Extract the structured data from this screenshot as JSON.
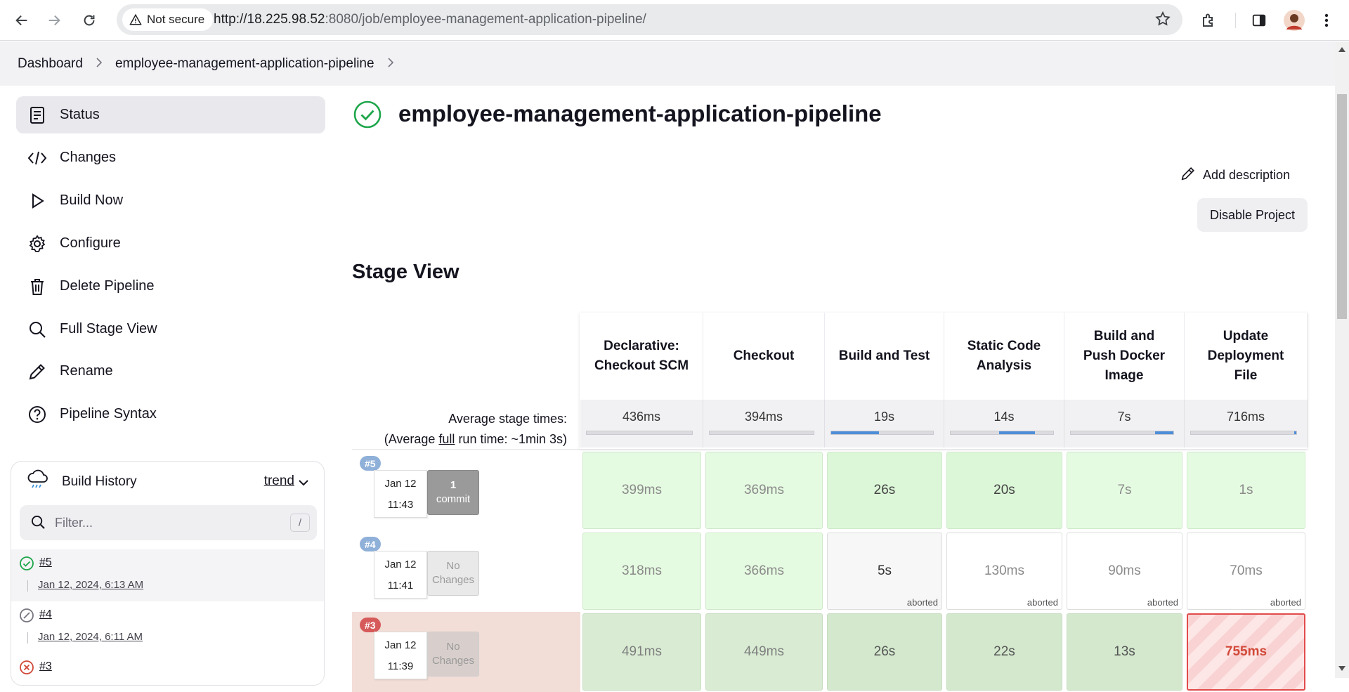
{
  "browser": {
    "security_label": "Not secure",
    "url_host": "http://18.225.98.52",
    "url_path": ":8080/job/employee-management-application-pipeline/"
  },
  "breadcrumb": {
    "items": [
      "Dashboard",
      "employee-management-application-pipeline"
    ]
  },
  "sidebar": {
    "items": [
      {
        "label": "Status",
        "icon": "status-icon"
      },
      {
        "label": "Changes",
        "icon": "code-icon"
      },
      {
        "label": "Build Now",
        "icon": "play-icon"
      },
      {
        "label": "Configure",
        "icon": "gear-icon"
      },
      {
        "label": "Delete Pipeline",
        "icon": "trash-icon"
      },
      {
        "label": "Full Stage View",
        "icon": "search-icon"
      },
      {
        "label": "Rename",
        "icon": "pencil-icon"
      },
      {
        "label": "Pipeline Syntax",
        "icon": "help-icon"
      }
    ]
  },
  "build_history": {
    "title": "Build History",
    "trend_label": "trend",
    "filter_placeholder": "Filter...",
    "filter_shortcut": "/",
    "builds": [
      {
        "number": "#5",
        "date": "Jan 12, 2024, 6:13 AM",
        "status": "success"
      },
      {
        "number": "#4",
        "date": "Jan 12, 2024, 6:11 AM",
        "status": "aborted"
      },
      {
        "number": "#3",
        "date": "",
        "status": "failed"
      }
    ]
  },
  "main": {
    "title": "employee-management-application-pipeline",
    "add_description": "Add description",
    "disable_project": "Disable Project",
    "stage_view_title": "Stage View"
  },
  "stage_view": {
    "avg_label_1": "Average stage times:",
    "avg_label_2_prefix": "(Average ",
    "avg_label_2_link": "full",
    "avg_label_2_suffix": " run time: ~1min 3s)",
    "stages": [
      {
        "name": "Declarative: Checkout SCM",
        "avg": "436ms",
        "bar_start": 0,
        "bar_fill": 0
      },
      {
        "name": "Checkout",
        "avg": "394ms",
        "bar_start": 0,
        "bar_fill": 0
      },
      {
        "name": "Build and Test",
        "avg": "19s",
        "bar_start": 0,
        "bar_fill": 0.47
      },
      {
        "name": "Static Code Analysis",
        "avg": "14s",
        "bar_start": 0.47,
        "bar_fill": 0.35
      },
      {
        "name": "Build and Push Docker Image",
        "avg": "7s",
        "bar_start": 0.82,
        "bar_fill": 0.18
      },
      {
        "name": "Update Deployment File",
        "avg": "716ms",
        "bar_start": 0.98,
        "bar_fill": 0.02
      }
    ],
    "runs": [
      {
        "badge": "#5",
        "badge_color": "#8fb0d8",
        "date": "Jan 12",
        "time": "11:43",
        "commit_line1": "1",
        "commit_line2": "commit",
        "cells": [
          {
            "value": "399ms",
            "state": "success"
          },
          {
            "value": "369ms",
            "state": "success"
          },
          {
            "value": "26s",
            "state": "success-strong"
          },
          {
            "value": "20s",
            "state": "success-strong"
          },
          {
            "value": "7s",
            "state": "success"
          },
          {
            "value": "1s",
            "state": "success"
          }
        ]
      },
      {
        "badge": "#4",
        "badge_color": "#8fb0d8",
        "date": "Jan 12",
        "time": "11:41",
        "commit_line1": "No",
        "commit_line2": "Changes",
        "cells": [
          {
            "value": "318ms",
            "state": "success"
          },
          {
            "value": "366ms",
            "state": "success"
          },
          {
            "value": "5s",
            "state": "aborted",
            "tag": "aborted"
          },
          {
            "value": "130ms",
            "state": "aborted-light",
            "tag": "aborted"
          },
          {
            "value": "90ms",
            "state": "aborted-light",
            "tag": "aborted"
          },
          {
            "value": "70ms",
            "state": "aborted-light",
            "tag": "aborted"
          }
        ]
      },
      {
        "badge": "#3",
        "badge_color": "#d65a5a",
        "date": "Jan 12",
        "time": "11:39",
        "commit_line1": "No",
        "commit_line2": "Changes",
        "cells": [
          {
            "value": "491ms",
            "state": "success-dim"
          },
          {
            "value": "449ms",
            "state": "success-dim"
          },
          {
            "value": "26s",
            "state": "success-dim-strong"
          },
          {
            "value": "22s",
            "state": "success-dim-strong"
          },
          {
            "value": "13s",
            "state": "success-dim-strong"
          },
          {
            "value": "755ms",
            "state": "failed"
          }
        ]
      }
    ]
  },
  "colors": {
    "success_icon": "#1ea64b",
    "failed_icon": "#d24939",
    "bar_fill": "#4d8ed8"
  }
}
